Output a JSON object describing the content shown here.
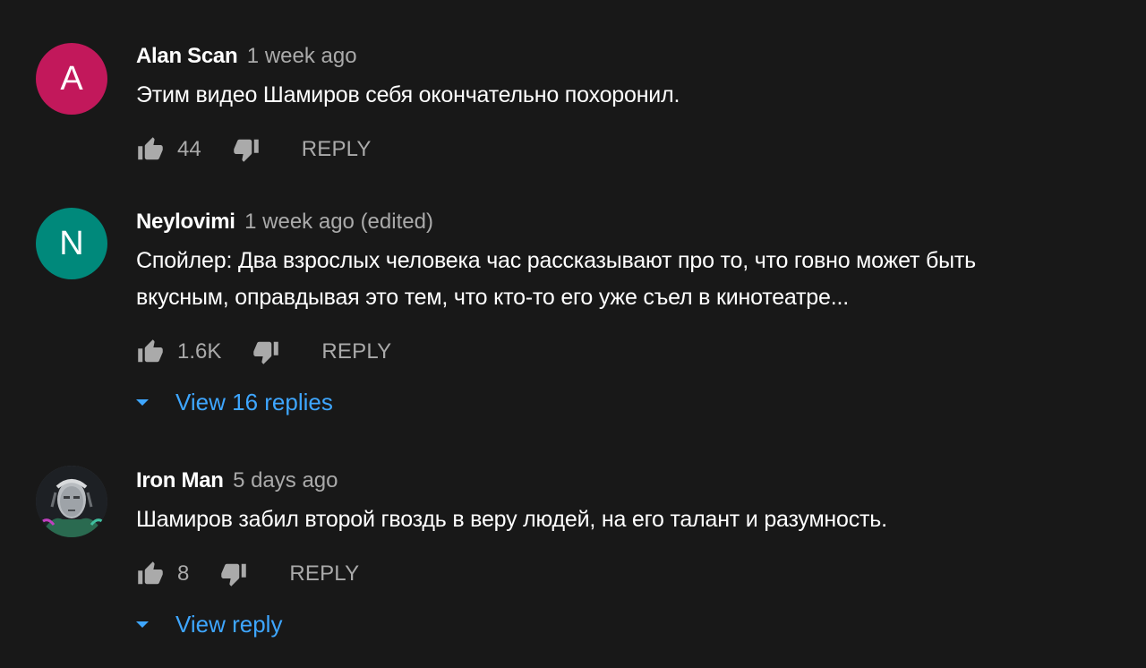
{
  "comments": [
    {
      "avatar_letter": "A",
      "avatar_color": "#c2185b",
      "author": "Alan Scan",
      "time": "1 week ago",
      "lines": [
        "Этим видео Шамиров себя окончательно похоронил."
      ],
      "likes": "44",
      "reply_label": "REPLY"
    },
    {
      "avatar_letter": "N",
      "avatar_color": "#00897b",
      "author": "Neylovimi",
      "time": "1 week ago (edited)",
      "lines": [
        "Спойлер: Два взрослых человека час рассказывают про то, что говно может быть",
        "вкусным, оправдывая это тем, что кто-то его уже съел в кинотеатре..."
      ],
      "likes": "1.6K",
      "reply_label": "REPLY",
      "view_replies": "View 16 replies"
    },
    {
      "avatar_icon": "iron-man-photo",
      "author": "Iron Man",
      "time": "5 days ago",
      "lines": [
        "Шамиров забил второй гвоздь в веру людей, на его талант и разумность."
      ],
      "likes": "8",
      "reply_label": "REPLY",
      "view_replies": "View reply"
    }
  ],
  "colors": {
    "background": "#181818",
    "secondary_text": "#aaaaaa",
    "link": "#3ea6ff"
  }
}
